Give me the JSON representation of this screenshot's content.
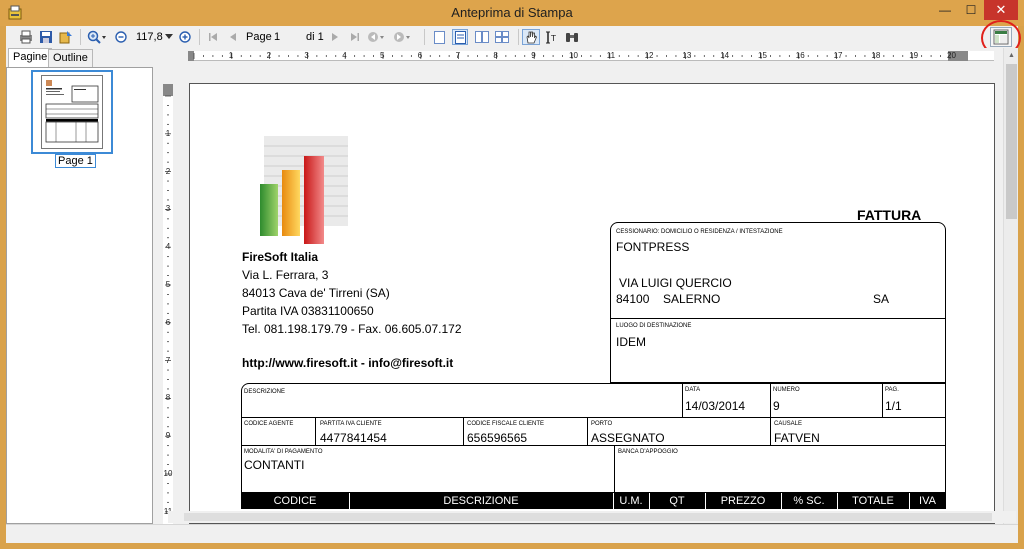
{
  "window": {
    "title": "Anteprima di Stampa",
    "minimize": "—",
    "maximize": "☐",
    "close": "✕"
  },
  "toolbar": {
    "zoom_value": "117,8",
    "page_label": "Page",
    "page_current": "1",
    "page_total_label": "di 1"
  },
  "left_panel": {
    "tabs": [
      "Pagine",
      "Outline"
    ],
    "thumbnail_label": "Page 1"
  },
  "ruler": {
    "h_marks": [
      "1",
      "2",
      "3",
      "4",
      "5",
      "6",
      "7",
      "8",
      "9",
      "10",
      "11",
      "12",
      "13",
      "14",
      "15",
      "16",
      "17",
      "18",
      "19",
      "20"
    ],
    "v_marks": [
      "1",
      "2",
      "3",
      "4",
      "5",
      "6",
      "7",
      "8",
      "9",
      "10",
      "11"
    ]
  },
  "document": {
    "doc_type": "FATTURA",
    "company": {
      "name": "FireSoft Italia",
      "address": "Via L. Ferrara, 3",
      "city": "84013 Cava de' Tirreni (SA)",
      "vat": "Partita IVA 03831100650",
      "phone": "Tel. 081.198.179.79 - Fax. 06.605.07.172",
      "web": "http://www.firesoft.it - info@firesoft.it"
    },
    "recipient": {
      "label": "CESSIONARIO: DOMICILIO O RESIDENZA / INTESTAZIONE",
      "name": "FONTPRESS",
      "street": "VIA LUIGI QUERCIO",
      "zip": "84100",
      "city": "SALERNO",
      "province": "SA"
    },
    "destination": {
      "label": "LUOGO DI DESTINAZIONE",
      "value": "IDEM"
    },
    "row1": {
      "descrizione_label": "DESCRIZIONE",
      "data_label": "DATA",
      "data_value": "14/03/2014",
      "numero_label": "NUMERO",
      "numero_value": "9",
      "pag_label": "PAG.",
      "pag_value": "1/1"
    },
    "row2": {
      "agente_label": "CODICE AGENTE",
      "piva_label": "PARTITA IVA CLIENTE",
      "piva_value": "4477841454",
      "cf_label": "CODICE FISCALE CLIENTE",
      "cf_value": "656596565",
      "porto_label": "PORTO",
      "porto_value": "ASSEGNATO",
      "causale_label": "CAUSALE",
      "causale_value": "FATVEN"
    },
    "row3": {
      "pagamento_label": "MODALITA' DI PAGAMENTO",
      "pagamento_value": "CONTANTI",
      "banca_label": "BANCA D'APPOGGIO"
    },
    "table_headers": [
      "CODICE",
      "DESCRIZIONE",
      "U.M.",
      "QT",
      "PREZZO",
      "% SC.",
      "TOTALE",
      "IVA"
    ]
  },
  "colors": {
    "frame": "#dda44c",
    "close": "#c7342b",
    "selection": "#3c8ad6",
    "highlight_circle": "#e0211b"
  }
}
